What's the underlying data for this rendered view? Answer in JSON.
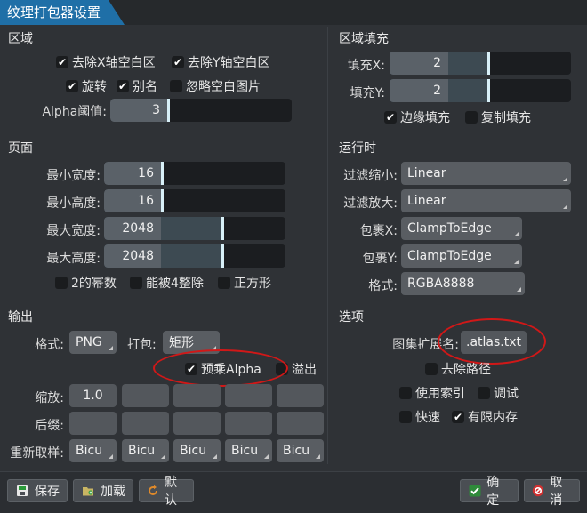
{
  "window": {
    "title": "纹理打包器设置"
  },
  "region": {
    "title": "区域",
    "strip_x": "去除X轴空白区",
    "strip_y": "去除Y轴空白区",
    "rotation": "旋转",
    "alias": "别名",
    "ignore_blank": "忽略空白图片",
    "alpha_threshold_label": "Alpha阈值:",
    "alpha_threshold_value": "3"
  },
  "region_fill": {
    "title": "区域填充",
    "pad_x_label": "填充X:",
    "pad_x_value": "2",
    "pad_y_label": "填充Y:",
    "pad_y_value": "2",
    "edge_padding": "边缘填充",
    "duplicate_padding": "复制填充"
  },
  "page": {
    "title": "页面",
    "min_width_label": "最小宽度:",
    "min_width_value": "16",
    "min_height_label": "最小高度:",
    "min_height_value": "16",
    "max_width_label": "最大宽度:",
    "max_width_value": "2048",
    "max_height_label": "最大高度:",
    "max_height_value": "2048",
    "power_of_two": "2的幂数",
    "multiple_of_four": "能被4整除",
    "square": "正方形"
  },
  "runtime": {
    "title": "运行时",
    "filter_min_label": "过滤缩小:",
    "filter_min_value": "Linear",
    "filter_mag_label": "过滤放大:",
    "filter_mag_value": "Linear",
    "wrap_x_label": "包裹X:",
    "wrap_x_value": "ClampToEdge",
    "wrap_y_label": "包裹Y:",
    "wrap_y_value": "ClampToEdge",
    "format_label": "格式:",
    "format_value": "RGBA8888"
  },
  "output": {
    "title": "输出",
    "format_label": "格式:",
    "format_value": "PNG",
    "packing_label": "打包:",
    "packing_value": "矩形",
    "premultiply_alpha": "预乘Alpha",
    "bleed": "溢出",
    "scale_label": "缩放:",
    "scale_values": [
      "1.0",
      "",
      "",
      "",
      ""
    ],
    "suffix_label": "后缀:",
    "resample_label": "重新取样:",
    "resample_values": [
      "Bicu",
      "Bicu",
      "Bicu",
      "Bicu",
      "Bicu"
    ]
  },
  "options": {
    "title": "选项",
    "atlas_ext_label": "图集扩展名:",
    "atlas_ext_value": ".atlas.txt",
    "strip_paths": "去除路径",
    "use_indexes": "使用索引",
    "debug": "调试",
    "fast": "快速",
    "limit_memory": "有限内存"
  },
  "buttons": {
    "save": "保存",
    "load": "加载",
    "defaults": "默认",
    "ok": "确定",
    "cancel": "取消"
  }
}
